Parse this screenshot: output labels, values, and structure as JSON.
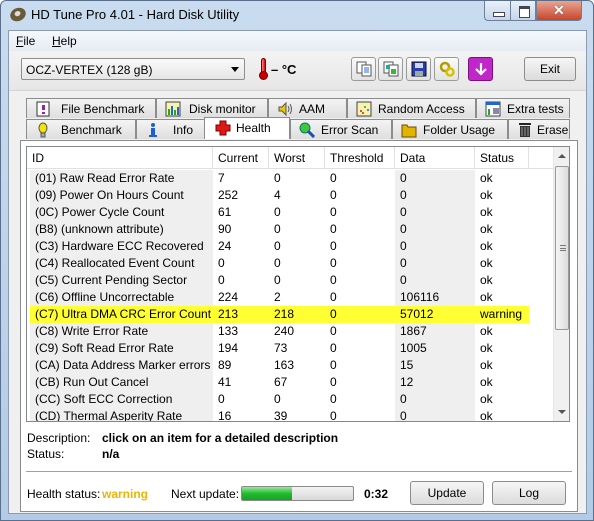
{
  "window": {
    "title": "HD Tune Pro 4.01 - Hard Disk Utility",
    "controls": [
      "minimize",
      "maximize",
      "close"
    ]
  },
  "menu": [
    {
      "label": "File",
      "accel": "F"
    },
    {
      "label": "Help",
      "accel": "H"
    }
  ],
  "toolbar": {
    "drive_selected": "OCZ-VERTEX (128 gB)",
    "temperature": "– °C",
    "icon_buttons": [
      "copy-text-icon",
      "copy-screenshot-icon",
      "save-icon",
      "options-icon",
      "download-icon"
    ],
    "exit_label": "Exit"
  },
  "tabs": {
    "row1": [
      {
        "label": "File Benchmark",
        "icon": "file-benchmark-icon"
      },
      {
        "label": "Disk monitor",
        "icon": "disk-monitor-icon"
      },
      {
        "label": "AAM",
        "icon": "speaker-icon"
      },
      {
        "label": "Random Access",
        "icon": "random-access-icon"
      },
      {
        "label": "Extra tests",
        "icon": "extra-tests-icon"
      }
    ],
    "row2": [
      {
        "label": "Benchmark",
        "icon": "benchmark-icon"
      },
      {
        "label": "Info",
        "icon": "info-icon"
      },
      {
        "label": "Health",
        "icon": "health-cross-icon",
        "active": true
      },
      {
        "label": "Error Scan",
        "icon": "magnifier-icon"
      },
      {
        "label": "Folder Usage",
        "icon": "folder-icon"
      },
      {
        "label": "Erase",
        "icon": "trash-icon"
      }
    ]
  },
  "table": {
    "columns": [
      "ID",
      "Current",
      "Worst",
      "Threshold",
      "Data",
      "Status"
    ],
    "rows": [
      {
        "id": "(01) Raw Read Error Rate",
        "current": "7",
        "worst": "0",
        "threshold": "0",
        "data": "0",
        "status": "ok"
      },
      {
        "id": "(09) Power On Hours Count",
        "current": "252",
        "worst": "4",
        "threshold": "0",
        "data": "0",
        "status": "ok"
      },
      {
        "id": "(0C) Power Cycle Count",
        "current": "61",
        "worst": "0",
        "threshold": "0",
        "data": "0",
        "status": "ok"
      },
      {
        "id": "(B8) (unknown attribute)",
        "current": "90",
        "worst": "0",
        "threshold": "0",
        "data": "0",
        "status": "ok"
      },
      {
        "id": "(C3) Hardware ECC Recovered",
        "current": "24",
        "worst": "0",
        "threshold": "0",
        "data": "0",
        "status": "ok"
      },
      {
        "id": "(C4) Reallocated Event Count",
        "current": "0",
        "worst": "0",
        "threshold": "0",
        "data": "0",
        "status": "ok"
      },
      {
        "id": "(C5) Current Pending Sector",
        "current": "0",
        "worst": "0",
        "threshold": "0",
        "data": "0",
        "status": "ok"
      },
      {
        "id": "(C6) Offline Uncorrectable",
        "current": "224",
        "worst": "2",
        "threshold": "0",
        "data": "106116",
        "status": "ok"
      },
      {
        "id": "(C7) Ultra DMA CRC Error Count",
        "current": "213",
        "worst": "218",
        "threshold": "0",
        "data": "57012",
        "status": "warning",
        "highlight": true
      },
      {
        "id": "(C8) Write Error Rate",
        "current": "133",
        "worst": "240",
        "threshold": "0",
        "data": "1867",
        "status": "ok"
      },
      {
        "id": "(C9) Soft Read Error Rate",
        "current": "194",
        "worst": "73",
        "threshold": "0",
        "data": "1005",
        "status": "ok"
      },
      {
        "id": "(CA) Data Address Marker errors",
        "current": "89",
        "worst": "163",
        "threshold": "0",
        "data": "15",
        "status": "ok"
      },
      {
        "id": "(CB) Run Out Cancel",
        "current": "41",
        "worst": "67",
        "threshold": "0",
        "data": "12",
        "status": "ok"
      },
      {
        "id": "(CC) Soft ECC Correction",
        "current": "0",
        "worst": "0",
        "threshold": "0",
        "data": "0",
        "status": "ok"
      },
      {
        "id": "(CD) Thermal Asperity Rate",
        "current": "16",
        "worst": "39",
        "threshold": "0",
        "data": "0",
        "status": "ok"
      }
    ],
    "highlight_color": "#ffff34"
  },
  "details": {
    "description_label": "Description:",
    "description_value": "click on an item for a detailed description",
    "status_label": "Status:",
    "status_value": "n/a"
  },
  "footer": {
    "health_label": "Health status:",
    "health_value": "warning",
    "health_color": "#f0b400",
    "next_update_label": "Next update:",
    "progress_fraction": 0.45,
    "countdown": "0:32",
    "update_label": "Update",
    "log_label": "Log"
  }
}
